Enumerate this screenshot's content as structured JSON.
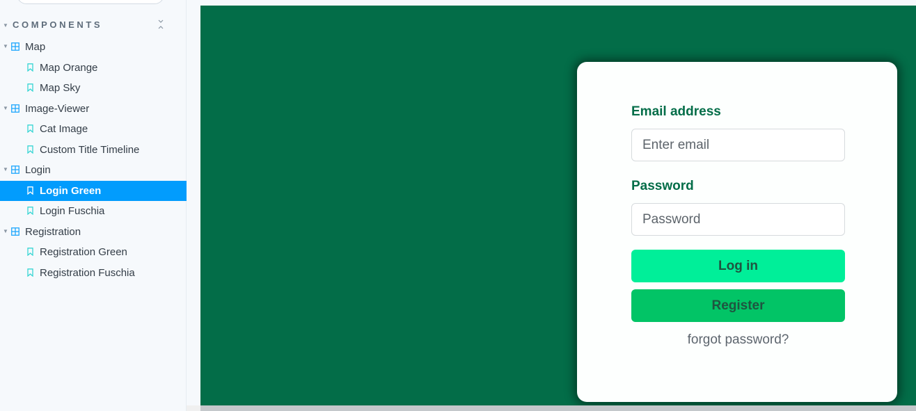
{
  "sidebar": {
    "section_label": "COMPONENTS",
    "tree": [
      {
        "kind": "folder",
        "label": "Map"
      },
      {
        "kind": "story",
        "label": "Map Orange"
      },
      {
        "kind": "story",
        "label": "Map Sky"
      },
      {
        "kind": "folder",
        "label": "Image-Viewer"
      },
      {
        "kind": "story",
        "label": "Cat Image"
      },
      {
        "kind": "story",
        "label": "Custom Title Timeline"
      },
      {
        "kind": "folder",
        "label": "Login"
      },
      {
        "kind": "story",
        "label": "Login Green",
        "selected": true
      },
      {
        "kind": "story",
        "label": "Login Fuschia"
      },
      {
        "kind": "folder",
        "label": "Registration"
      },
      {
        "kind": "story",
        "label": "Registration Green"
      },
      {
        "kind": "story",
        "label": "Registration Fuschia"
      }
    ],
    "icons": {
      "folder": "component-grid-icon",
      "story": "bookmark-icon",
      "collapse": "collapse-all-icon",
      "caret": "caret-down-icon"
    }
  },
  "login_form": {
    "email_label": "Email address",
    "email_placeholder": "Enter email",
    "email_value": "",
    "password_label": "Password",
    "password_placeholder": "Password",
    "password_value": "",
    "login_button": "Log in",
    "register_button": "Register",
    "forgot_link": "forgot password?"
  },
  "colors": {
    "preview_background": "#036d48",
    "card_background": "#fdfffe",
    "label_green": "#036d48",
    "login_button": "#00ef99",
    "register_button": "#02c466",
    "selected_row": "#029cfd"
  }
}
